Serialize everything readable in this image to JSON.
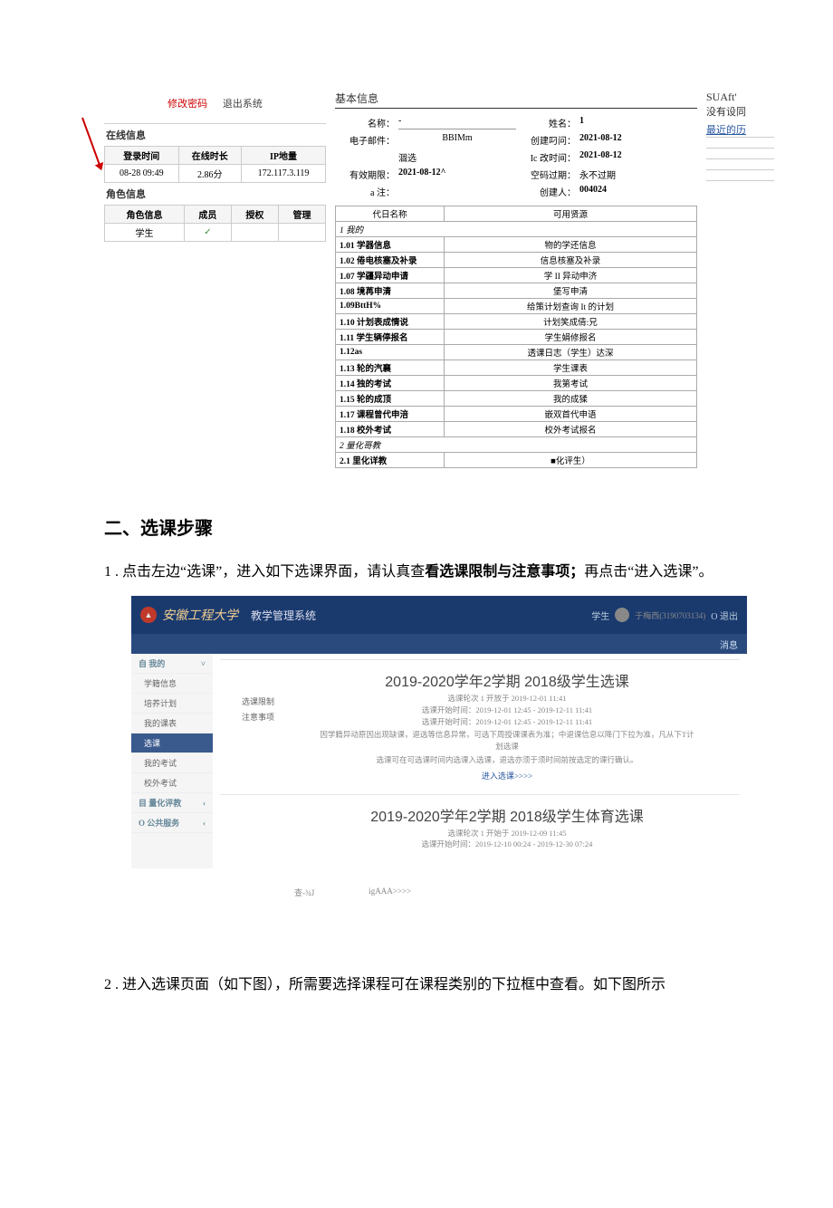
{
  "top": {
    "change_pwd": "修改密码",
    "exit": "退出系统"
  },
  "online": {
    "title": "在线信息",
    "headers": [
      "登录时间",
      "在线时长",
      "IP地量"
    ],
    "row": [
      "08-28 09:49",
      "2.86分",
      "172.117.3.119"
    ]
  },
  "role": {
    "title": "角色信息",
    "headers": [
      "角色信息",
      "成员",
      "授权",
      "管理"
    ],
    "row": [
      "学生",
      "✓",
      "",
      ""
    ]
  },
  "basic": {
    "title": "基本信息",
    "name_label": "名称：",
    "name_val": "-",
    "xingming_label": "姓名：",
    "xingming_val": "1",
    "email_label": "电子邮件：",
    "email_val": "BBIMm",
    "create_label": "创建叼问：",
    "create_val": "2021-08-12",
    "ban_label": "涸选",
    "change_label": "Ic 改时间：",
    "change_val": "2021-08-12",
    "valid_label": "有效期限：",
    "valid_val": "2021-08-12^",
    "pwd_label": "空码过期：",
    "pwd_val": "永不过期",
    "anote_label": "a 注：",
    "creator_label": "创建人：",
    "creator_val": "004024"
  },
  "perm": {
    "headers": [
      "代日名称",
      "可用贤源"
    ],
    "groups": [
      {
        "section": "1 我的"
      },
      {
        "left": "1.01 学器信息",
        "right": "物的学还信息"
      },
      {
        "left": "1.02 倦电核塞及补录",
        "right": "信息核塞及补录"
      },
      {
        "left": "1.07 学疆异动申请",
        "right": "学 II 异动申济"
      },
      {
        "left": "1.08 境苒申清",
        "right": "堡写申清"
      },
      {
        "left": "1.09BttH%",
        "right": "给策计划查询 It 的计划"
      },
      {
        "left": "1.10 计划表成情说",
        "right": "计划笑成倩:兄"
      },
      {
        "left": "1.11 学生辆停报名",
        "right": "学生娟修报名"
      },
      {
        "left": "1.12as",
        "right": "透课日志（学生）达深"
      },
      {
        "left": "1.13 轮的汽襄",
        "right": "学生课表"
      },
      {
        "left": "1.14 独的考试",
        "right": "我第考试"
      },
      {
        "left": "1.15 轮的成顶",
        "right": "我的成猱"
      },
      {
        "left": "1.17 课程曾代申涪",
        "right": "嵌双首代申语"
      },
      {
        "left": "1.18 校外考试",
        "right": "校外考试报名"
      },
      {
        "section": "2 量化哥教"
      },
      {
        "left": "2.1 里化详教",
        "right": "■化评生）"
      }
    ]
  },
  "right_box": {
    "suaft": "SUAft'",
    "norole": "没有设同",
    "recent": "最近的历"
  },
  "s2": {
    "heading": "二、选课步骤",
    "p1_prefix": "1 . 点击左边“选课”，进入如下选课界面，请认真查",
    "p1_bold": "看选课限制与注意事项；",
    "p1_rest": "再点击“进入选课”。",
    "p2": "2  . 进入选课页面（如下图），所需要选择课程可在课程类别的下拉框中查看。如下图所示"
  },
  "ss": {
    "brand": "安徽工程大学",
    "sys": "教学管理系统",
    "user_role": "学生",
    "logout": "O 退出",
    "msg": "消息",
    "sidebar_cat1": "自 我的",
    "side_items": [
      "学籍信息",
      "培养计划",
      "我的课表",
      "选课",
      "我的考试",
      "校外考试"
    ],
    "sidebar_cat2": "目 量化评教",
    "sidebar_cat3": "O 公共服务",
    "card1_title": "2019-2020学年2学期 2018级学生选课",
    "card1_sub1": "选课轮次 1 开放于 2019-12-01 11:41",
    "card1_sub2": "选课开始时间：2019-12-01 12:45 - 2019-12-11 11:41",
    "card1_sub3": "选课开始时间：2019-12-01 12:45 - 2019-12-11 11:41",
    "card1_label1": "选课限制",
    "card1_label2": "注意事项",
    "card1_desc1": "因学籍异动原因出现缺课，退选等信息异常，可选下周授课课表为准；中退课信息以降门下拉为准，凡从下T计划选课",
    "card1_desc2": "选课可在可选课时间内选课入选课，退选亦须于须时间前按选定的课行确认。",
    "card1_enter": "进入选课>>>>",
    "card2_title": "2019-2020学年2学期 2018级学生体育选课",
    "card2_sub1": "选课轮次 1 开始于 2019-12-09 11:45",
    "card2_sub2": "选课开始时间：2019-12-10 00:24 - 2019-12-30 07:24",
    "footer1": "查-¾J",
    "footer2": "igAAA>>>>"
  }
}
